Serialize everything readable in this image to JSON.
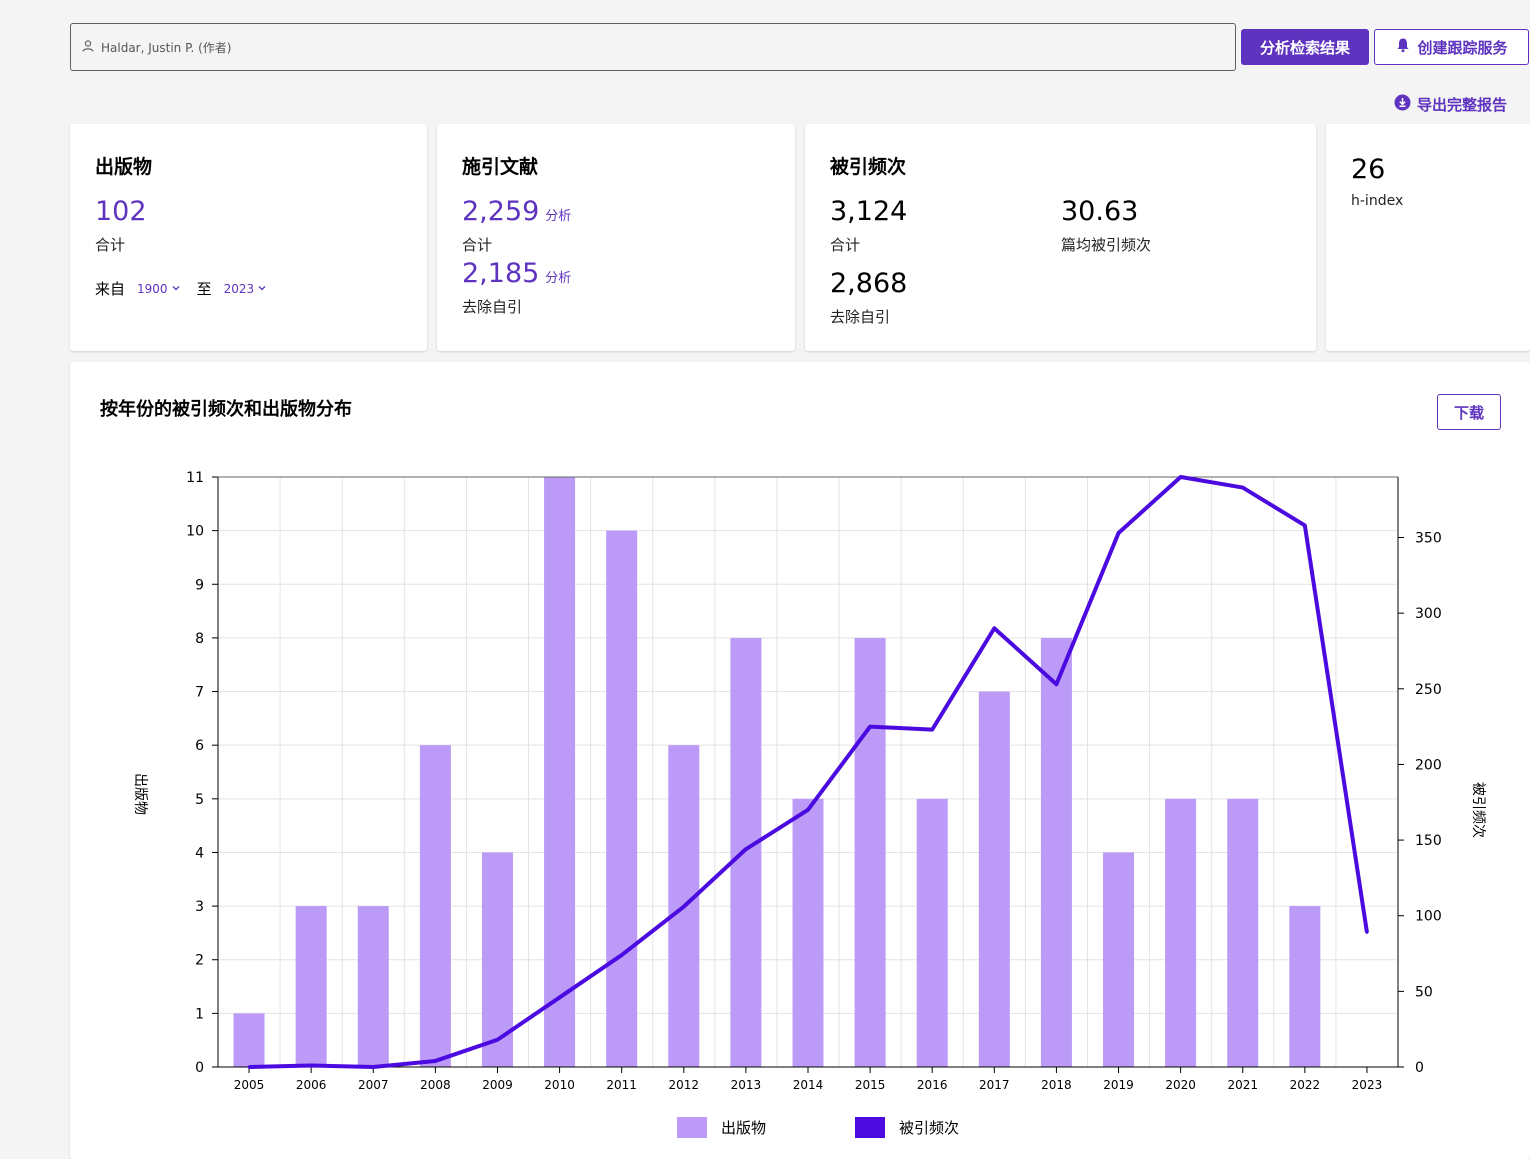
{
  "search": {
    "query": "Haldar, Justin P. (作者)",
    "icon": "user-icon"
  },
  "toolbar": {
    "analyze_label": "分析检索结果",
    "alert_label": "创建跟踪服务",
    "alert_icon": "bell-icon"
  },
  "export": {
    "label": "导出完整报告",
    "icon": "download-icon"
  },
  "cards": {
    "publications": {
      "title": "出版物",
      "total": "102",
      "total_label": "合计",
      "from_label": "来自",
      "from_value": "1900",
      "to_label": "至",
      "to_value": "2023"
    },
    "citing": {
      "title": "施引文献",
      "total": "2,259",
      "total_label": "合计",
      "no_self": "2,185",
      "no_self_label": "去除自引",
      "analyze_label": "分析"
    },
    "times_cited": {
      "title": "被引频次",
      "total": "3,124",
      "total_label": "合计",
      "average": "30.63",
      "average_label": "篇均被引频次",
      "no_self": "2,868",
      "no_self_label": "去除自引"
    },
    "hindex": {
      "value": "26",
      "label": "h-index"
    }
  },
  "chart_panel": {
    "title": "按年份的被引频次和出版物分布",
    "download_label": "下载"
  },
  "colors": {
    "accent": "#5e33bf",
    "bar": "#bb9af8",
    "line": "#4b0ae0"
  },
  "chart_data": {
    "type": "bar",
    "categories": [
      "2005",
      "2006",
      "2007",
      "2008",
      "2009",
      "2010",
      "2011",
      "2012",
      "2013",
      "2014",
      "2015",
      "2016",
      "2017",
      "2018",
      "2019",
      "2020",
      "2021",
      "2022",
      "2023"
    ],
    "series": [
      {
        "name": "出版物",
        "type": "bar",
        "axis": "left",
        "values": [
          1,
          3,
          3,
          6,
          4,
          11,
          10,
          6,
          8,
          5,
          8,
          5,
          7,
          8,
          4,
          5,
          5,
          3,
          0
        ]
      },
      {
        "name": "被引频次",
        "type": "line",
        "axis": "right",
        "values": [
          0,
          1,
          0,
          4,
          18,
          46,
          74,
          106,
          144,
          170,
          225,
          223,
          290,
          253,
          353,
          390,
          383,
          358,
          89
        ]
      }
    ],
    "ylabel": "出版物",
    "y2label": "被引频次",
    "ylim": [
      0,
      11
    ],
    "y2lim": [
      0,
      390
    ],
    "yticks": [
      0,
      1,
      2,
      3,
      4,
      5,
      6,
      7,
      8,
      9,
      10,
      11
    ],
    "y2ticks": [
      0,
      50,
      100,
      150,
      200,
      250,
      300,
      350
    ],
    "grid": true,
    "legend": "bottom"
  }
}
